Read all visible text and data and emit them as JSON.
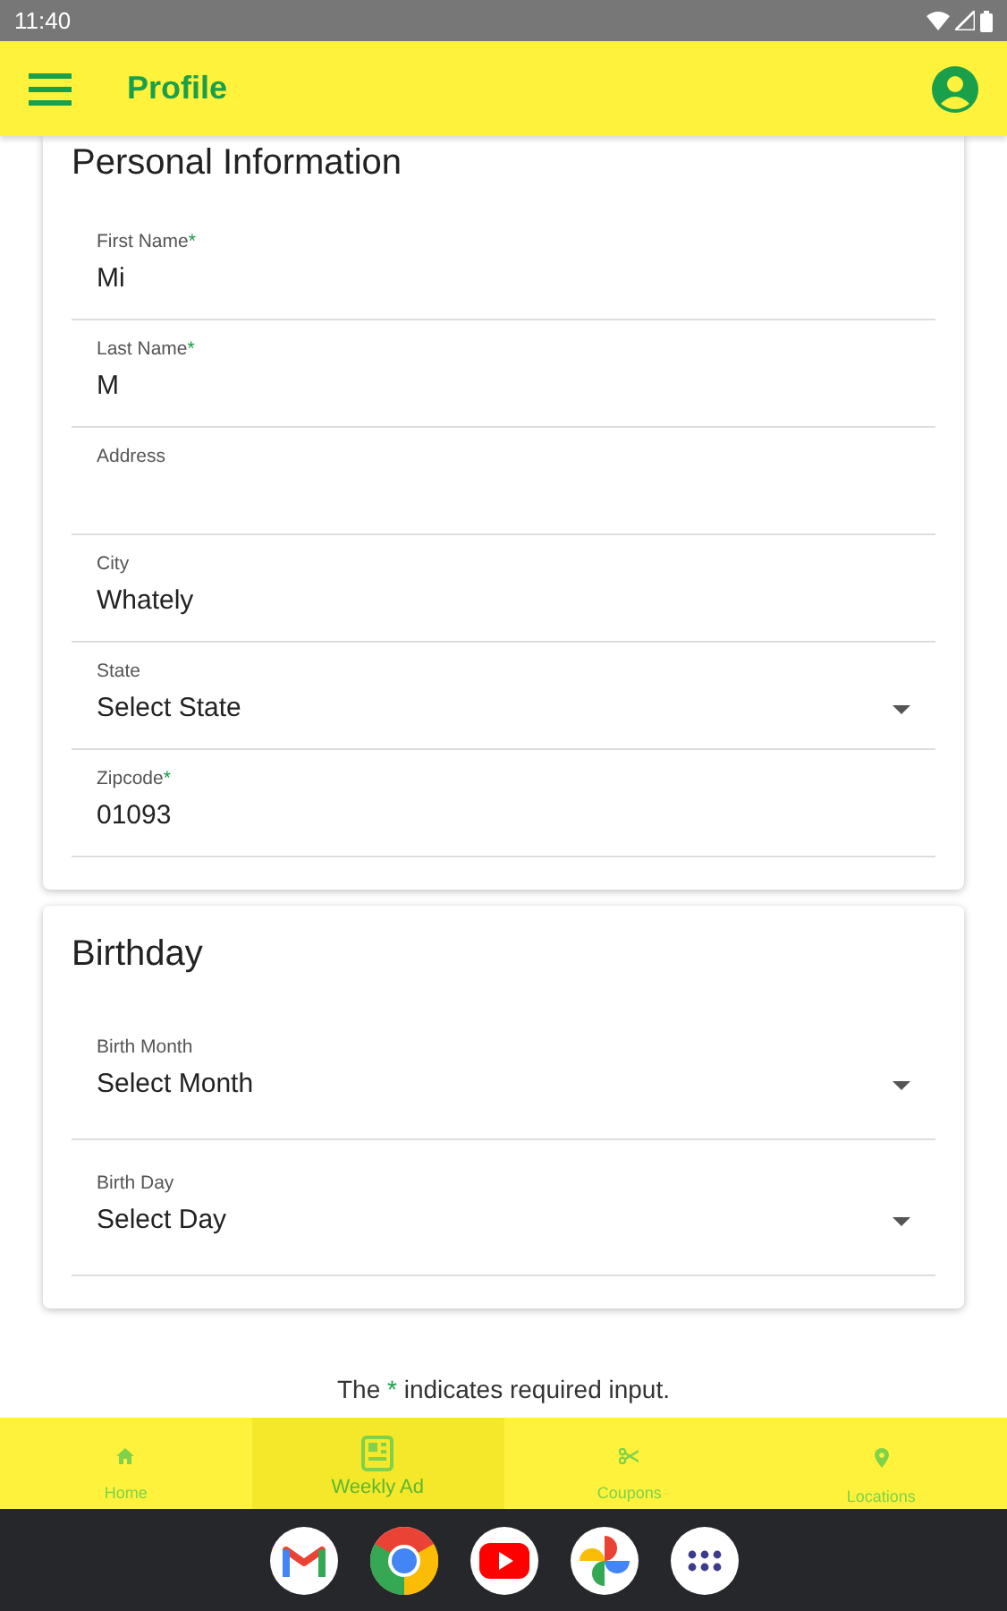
{
  "status_bar": {
    "time": "11:40"
  },
  "app_bar": {
    "title": "Profile"
  },
  "sections": [
    {
      "title": "Personal Information",
      "fields": [
        {
          "kind": "text",
          "label": "First Name",
          "required": true,
          "value": "Mi"
        },
        {
          "kind": "text",
          "label": "Last Name",
          "required": true,
          "value": "M"
        },
        {
          "kind": "text",
          "label": "Address",
          "required": false
        },
        {
          "kind": "text",
          "label": "City",
          "required": false,
          "value": "Whately"
        },
        {
          "kind": "select",
          "label": "State",
          "required": false,
          "value": "Select State"
        },
        {
          "kind": "text",
          "label": "Zipcode",
          "required": true,
          "value": "01093"
        }
      ]
    },
    {
      "title": "Birthday",
      "fields": [
        {
          "kind": "select",
          "label": "Birth Month",
          "required": false,
          "value": "Select Month"
        },
        {
          "kind": "select",
          "label": "Birth Day",
          "required": false,
          "value": "Select Day"
        }
      ]
    }
  ],
  "required_note": {
    "before": "The",
    "mark": "*",
    "after": "indicates required input."
  },
  "bottom_nav": [
    {
      "kind": "home",
      "label": "Home",
      "selected": false
    },
    {
      "kind": "ad",
      "label": "Weekly Ad",
      "selected": true
    },
    {
      "kind": "coupon",
      "label": "Coupons",
      "selected": false
    },
    {
      "kind": "location",
      "label": "Locations",
      "selected": false
    }
  ],
  "dock": [
    {
      "kind": "mail"
    },
    {
      "kind": "browser"
    },
    {
      "kind": "video"
    },
    {
      "kind": "photos"
    },
    {
      "kind": "apps"
    }
  ]
}
